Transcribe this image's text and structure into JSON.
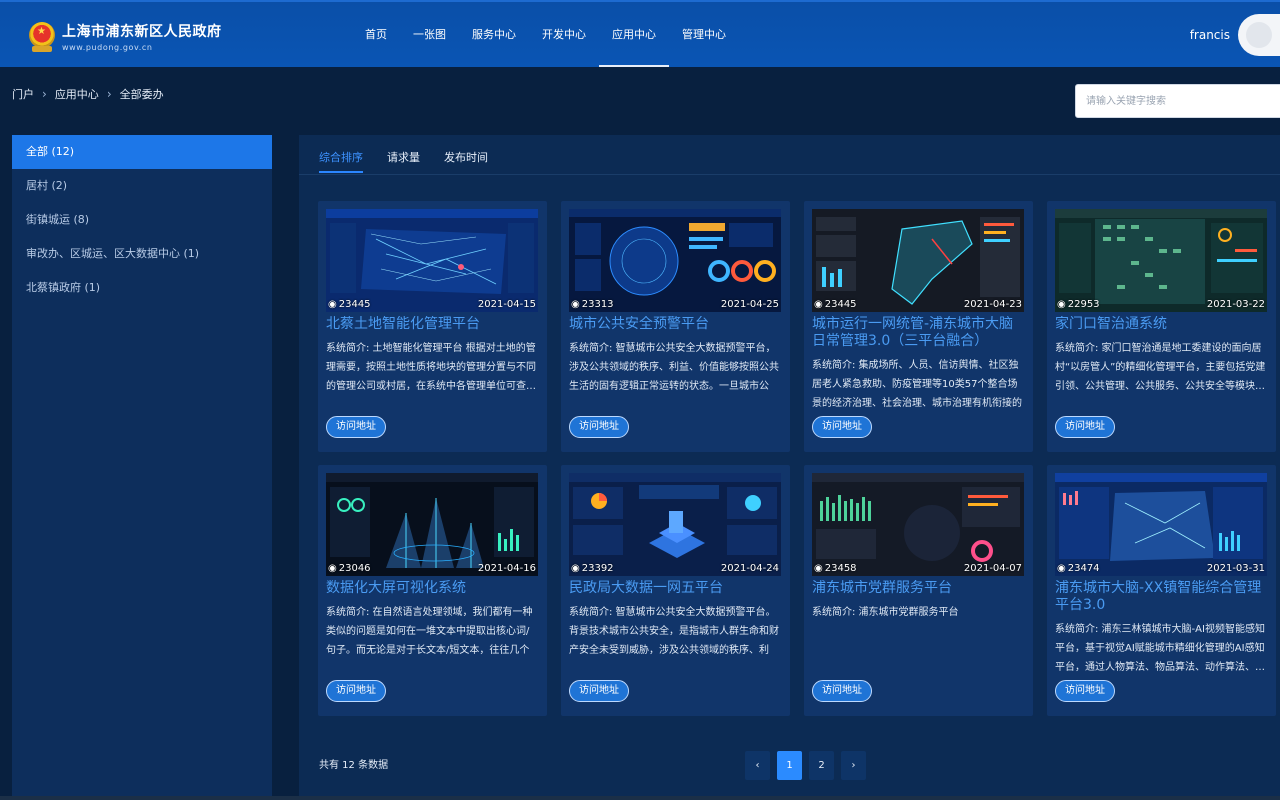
{
  "header": {
    "site_title": "上海市浦东新区人民政府",
    "site_domain": "www.pudong.gov.cn",
    "nav": [
      {
        "label": "首页"
      },
      {
        "label": "一张图"
      },
      {
        "label": "服务中心"
      },
      {
        "label": "开发中心"
      },
      {
        "label": "应用中心"
      },
      {
        "label": "管理中心"
      }
    ],
    "active_nav": "应用中心",
    "user_name": "francis"
  },
  "breadcrumb": [
    "门户",
    "应用中心",
    "全部委办"
  ],
  "search": {
    "placeholder": "请输入关键字搜索",
    "value": ""
  },
  "sidebar": {
    "items": [
      {
        "label": "全部 (12)"
      },
      {
        "label": "居村 (2)"
      },
      {
        "label": "街镇城运 (8)"
      },
      {
        "label": "审改办、区城运、区大数据中心 (1)"
      },
      {
        "label": "北蔡镇政府 (1)"
      }
    ],
    "active": "全部 (12)"
  },
  "tabs": [
    {
      "label": "综合排序"
    },
    {
      "label": "请求量"
    },
    {
      "label": "发布时间"
    }
  ],
  "active_tab": "综合排序",
  "cards": [
    {
      "views": "23445",
      "date": "2021-04-15",
      "title": "北蔡土地智能化管理平台",
      "desc": "系统简介: 土地智能化管理平台 根据对土地的管理需要，按照土地性质将地块的管理分置与不同的管理公司或村居，在系统中各管理单位可查…",
      "button": "访问地址"
    },
    {
      "views": "23313",
      "date": "2021-04-25",
      "title": "城市公共安全预警平台",
      "desc": "系统简介: 智慧城市公共安全大数据预警平台，涉及公共领域的秩序、利益、价值能够按照公共生活的固有逻辑正常运转的状态。一旦城市公共…",
      "button": "访问地址"
    },
    {
      "views": "23445",
      "date": "2021-04-23",
      "title": "城市运行一网统管-浦东城市大脑日常管理3.0（三平台融合）",
      "desc": "系统简介: 集成场所、人员、信访舆情、社区独居老人紧急救助、防疫管理等10类57个整合场景的经济治理、社会治理、城市治理有机衔接的平…",
      "button": "访问地址"
    },
    {
      "views": "22953",
      "date": "2021-03-22",
      "title": "家门口智治通系统",
      "desc": "系统简介: 家门口智治通是地工委建设的面向居村“以房管人”的精细化管理平台，主要包括党建引领、公共管理、公共服务、公共安全等模块…",
      "button": "访问地址"
    },
    {
      "views": "23046",
      "date": "2021-04-16",
      "title": "数据化大屏可视化系统",
      "desc": "系统简介: 在自然语言处理领域，我们都有一种类似的问题是如何在一堆文本中提取出核心词/句子。而无论是对于长文本/短文本，往往几个关…",
      "button": "访问地址"
    },
    {
      "views": "23392",
      "date": "2021-04-24",
      "title": "民政局大数据一网五平台",
      "desc": "系统简介: 智慧城市公共安全大数据预警平台。背景技术城市公共安全，是指城市人群生命和财产安全未受到威胁，涉及公共领域的秩序、利益…",
      "button": "访问地址"
    },
    {
      "views": "23458",
      "date": "2021-04-07",
      "title": "浦东城市党群服务平台",
      "desc": "系统简介: 浦东城市党群服务平台",
      "button": "访问地址"
    },
    {
      "views": "23474",
      "date": "2021-03-31",
      "title": "浦东城市大脑-XX镇智能综合管理平台3.0",
      "desc": "系统简介: 浦东三林镇城市大脑-AI视频智能感知平台，基于视觉AI赋能城市精细化管理的AI感知平台，通过人物算法、物品算法、动作算法、…",
      "button": "访问地址"
    }
  ],
  "pagination": {
    "total_text": "共有 12 条数据",
    "pages": [
      "1",
      "2"
    ],
    "current": "1",
    "prev_icon": "‹",
    "next_icon": "›"
  },
  "colors": {
    "header": "#0a55b4",
    "accent": "#2b8bff",
    "page_bg": "#08203f",
    "card_bg": "#11356a"
  }
}
